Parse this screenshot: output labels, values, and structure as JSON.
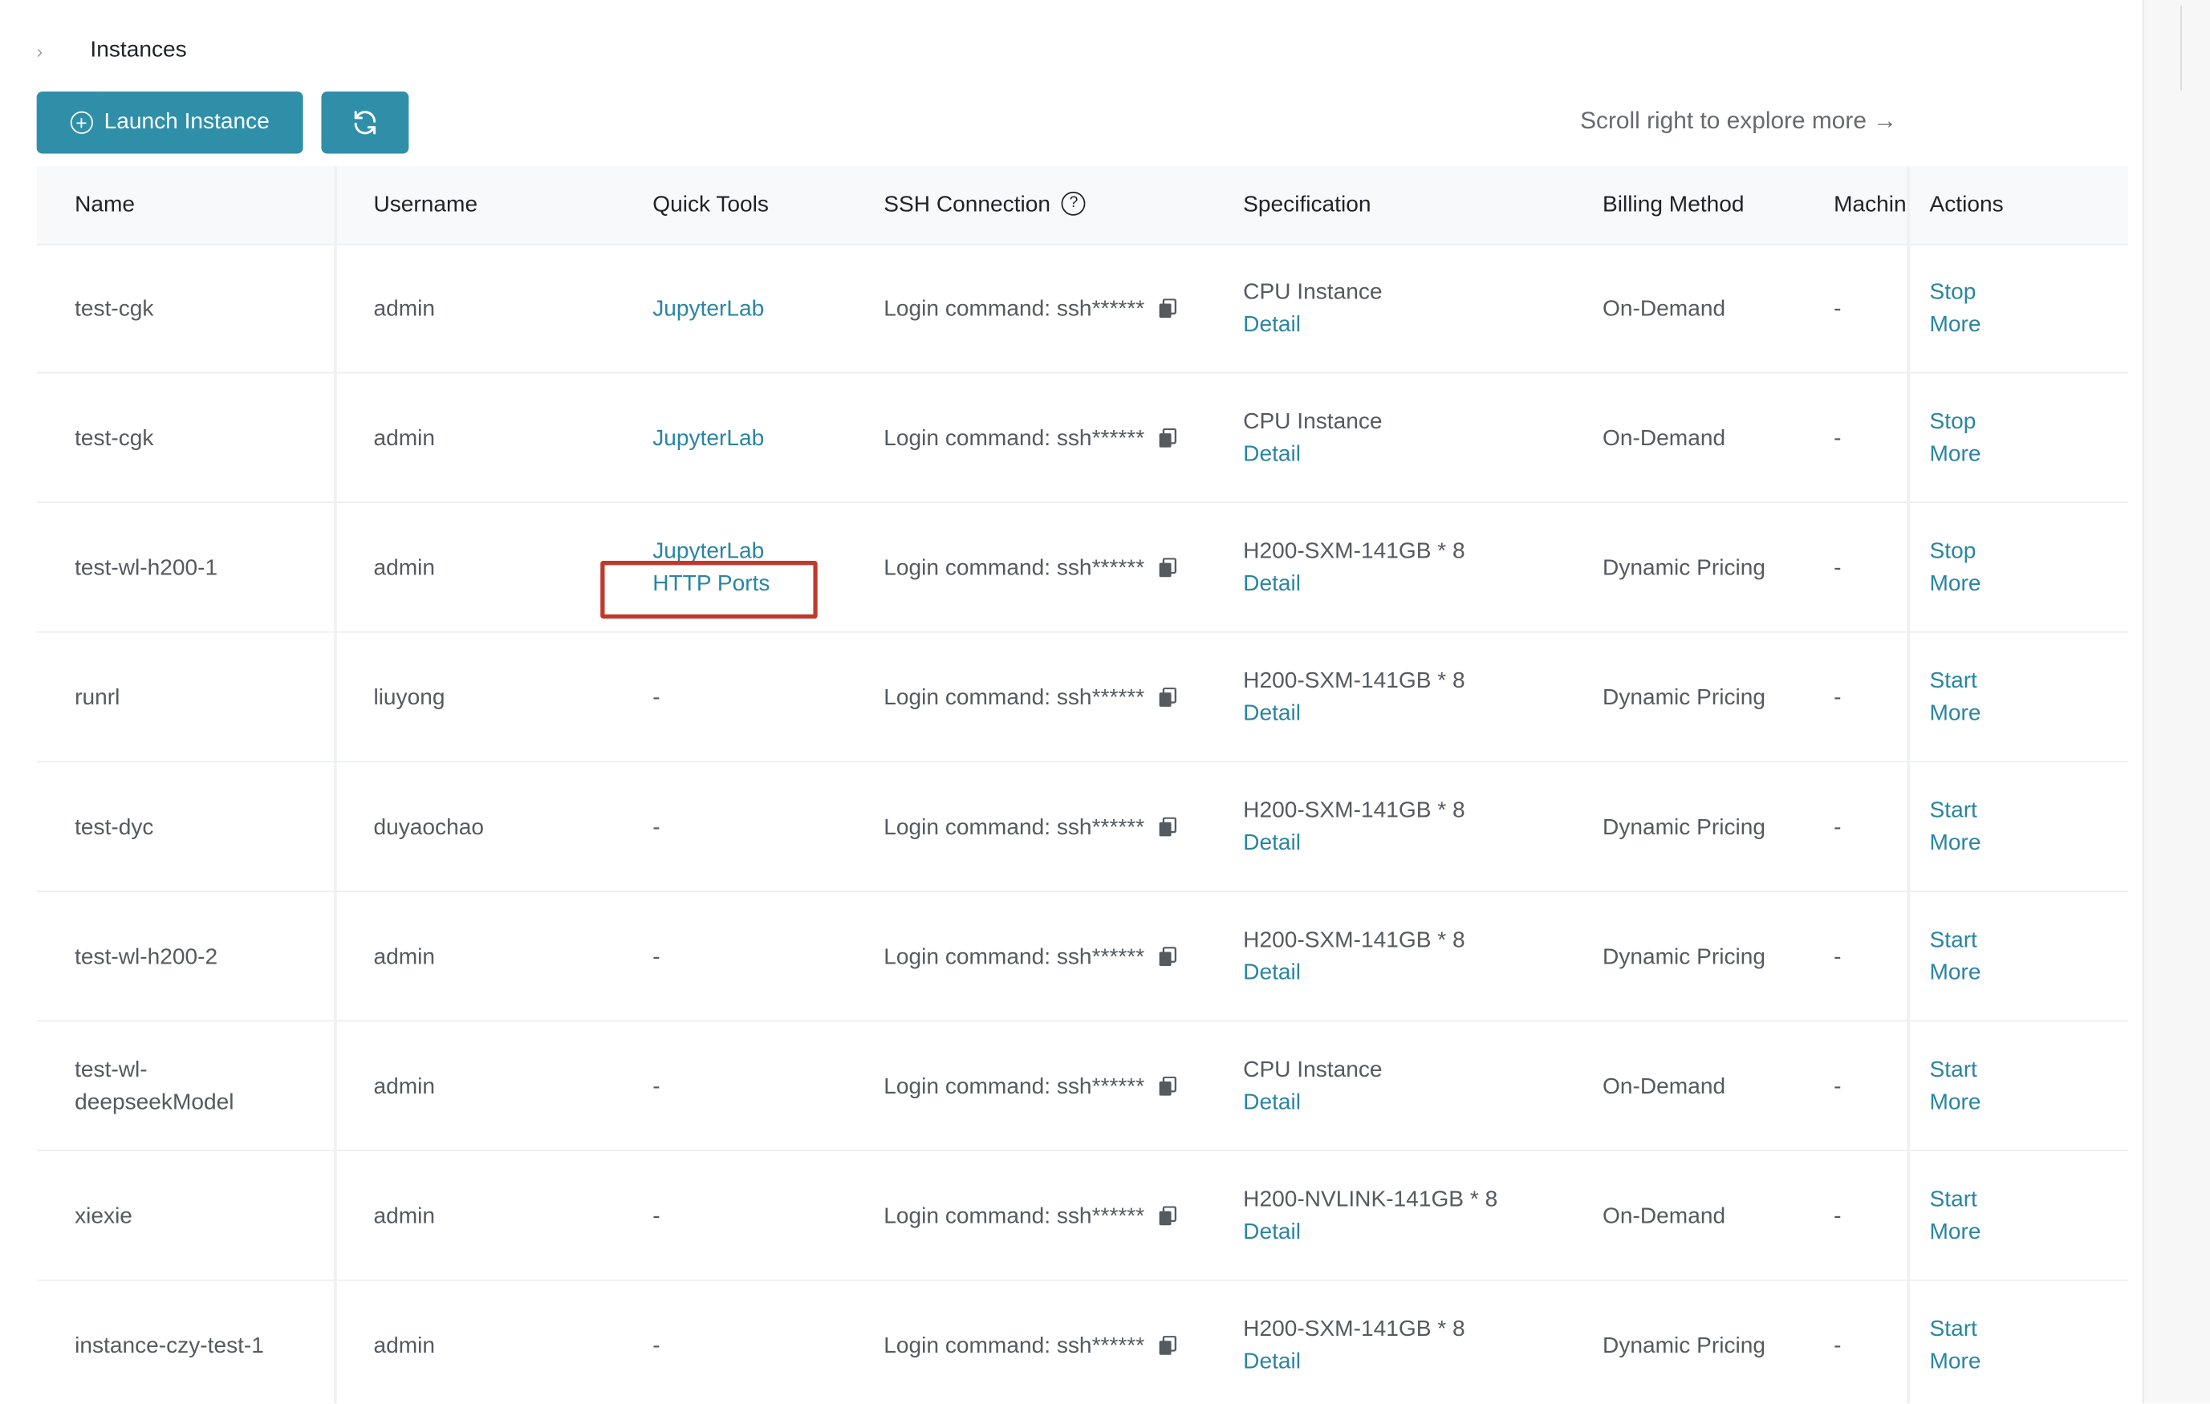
{
  "breadcrumb": {
    "title": "Instances"
  },
  "toolbar": {
    "launch_label": "Launch Instance",
    "scroll_hint": "Scroll right to explore more →"
  },
  "table": {
    "columns": [
      "Name",
      "Username",
      "Quick Tools",
      "SSH Connection",
      "Specification",
      "Billing Method",
      "Machin",
      "Actions"
    ],
    "rows": [
      {
        "name": [
          "test-cgk"
        ],
        "username": "admin",
        "tools": [
          "JupyterLab"
        ],
        "ssh": "Login command: ssh******",
        "spec": "CPU Instance",
        "spec_link": "Detail",
        "billing": "On-Demand",
        "machine": "-",
        "actions": [
          "Stop",
          "More"
        ]
      },
      {
        "name": [
          "test-cgk"
        ],
        "username": "admin",
        "tools": [
          "JupyterLab"
        ],
        "ssh": "Login command: ssh******",
        "spec": "CPU Instance",
        "spec_link": "Detail",
        "billing": "On-Demand",
        "machine": "-",
        "actions": [
          "Stop",
          "More"
        ]
      },
      {
        "name": [
          "test-wl-h200-1"
        ],
        "username": "admin",
        "tools": [
          "JupyterLab",
          "HTTP Ports"
        ],
        "ssh": "Login command: ssh******",
        "spec": "H200-SXM-141GB * 8",
        "spec_link": "Detail",
        "billing": "Dynamic Pricing",
        "machine": "-",
        "actions": [
          "Stop",
          "More"
        ]
      },
      {
        "name": [
          "runrl"
        ],
        "username": "liuyong",
        "tools": [
          "-"
        ],
        "ssh": "Login command: ssh******",
        "spec": "H200-SXM-141GB * 8",
        "spec_link": "Detail",
        "billing": "Dynamic Pricing",
        "machine": "-",
        "actions": [
          "Start",
          "More"
        ]
      },
      {
        "name": [
          "test-dyc"
        ],
        "username": "duyaochao",
        "tools": [
          "-"
        ],
        "ssh": "Login command: ssh******",
        "spec": "H200-SXM-141GB * 8",
        "spec_link": "Detail",
        "billing": "Dynamic Pricing",
        "machine": "-",
        "actions": [
          "Start",
          "More"
        ]
      },
      {
        "name": [
          "test-wl-h200-2"
        ],
        "username": "admin",
        "tools": [
          "-"
        ],
        "ssh": "Login command: ssh******",
        "spec": "H200-SXM-141GB * 8",
        "spec_link": "Detail",
        "billing": "Dynamic Pricing",
        "machine": "-",
        "actions": [
          "Start",
          "More"
        ]
      },
      {
        "name": [
          "test-wl-",
          "deepseekModel"
        ],
        "username": "admin",
        "tools": [
          "-"
        ],
        "ssh": "Login command: ssh******",
        "spec": "CPU Instance",
        "spec_link": "Detail",
        "billing": "On-Demand",
        "machine": "-",
        "actions": [
          "Start",
          "More"
        ]
      },
      {
        "name": [
          "xiexie"
        ],
        "username": "admin",
        "tools": [
          "-"
        ],
        "ssh": "Login command: ssh******",
        "spec": "H200-NVLINK-141GB * 8",
        "spec_link": "Detail",
        "billing": "On-Demand",
        "machine": "-",
        "actions": [
          "Start",
          "More"
        ]
      },
      {
        "name": [
          "instance-czy-test-1"
        ],
        "username": "admin",
        "tools": [
          "-"
        ],
        "ssh": "Login command: ssh******",
        "spec": "H200-SXM-141GB * 8",
        "spec_link": "Detail",
        "billing": "Dynamic Pricing",
        "machine": "-",
        "actions": [
          "Start",
          "More"
        ]
      }
    ]
  },
  "icons": {
    "breadcrumb": "chevron-right-icon",
    "launch": "plus-circle-icon",
    "refresh": "refresh-icon",
    "help": "help-circle-icon",
    "copy": "copy-icon"
  },
  "colors": {
    "accent": "#2f8fa8",
    "link": "#2a85a0",
    "highlight": "#c0392b"
  }
}
